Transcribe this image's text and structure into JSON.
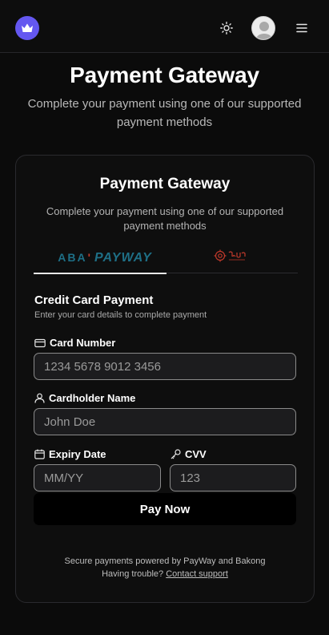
{
  "header": {
    "logo_icon": "crown-icon",
    "theme_icon": "sun-icon",
    "avatar_icon": "user-avatar",
    "menu_icon": "hamburger-menu-icon"
  },
  "hero": {
    "title": "Payment Gateway",
    "subtitle": "Complete your payment using one of our supported payment methods"
  },
  "card": {
    "title": "Payment Gateway",
    "subtitle": "Complete your payment using one of our supported payment methods",
    "tabs": [
      {
        "id": "aba",
        "aba_text": "ABA",
        "tick": "'",
        "payway_text": "PAYWAY",
        "active": true
      },
      {
        "id": "bakong",
        "logo_icon": "bakong-logo",
        "active": false
      }
    ],
    "section_title": "Credit Card Payment",
    "section_desc": "Enter your card details to complete payment",
    "fields": {
      "card_number": {
        "label": "Card Number",
        "placeholder": "1234 5678 9012 3456",
        "icon": "credit-card-icon"
      },
      "cardholder": {
        "label": "Cardholder Name",
        "placeholder": "John Doe",
        "icon": "user-icon"
      },
      "expiry": {
        "label": "Expiry Date",
        "placeholder": "MM/YY",
        "icon": "calendar-icon"
      },
      "cvv": {
        "label": "CVV",
        "placeholder": "123",
        "icon": "key-icon"
      }
    },
    "pay_button": "Pay Now",
    "footer_line1": "Secure payments powered by PayWay and Bakong",
    "footer_line2_prefix": "Having trouble? ",
    "footer_link": "Contact support"
  },
  "colors": {
    "background": "#0b0b0b",
    "accent": "#6457f0",
    "aba_blue": "#1e6f86",
    "bakong_red": "#c0392b"
  }
}
